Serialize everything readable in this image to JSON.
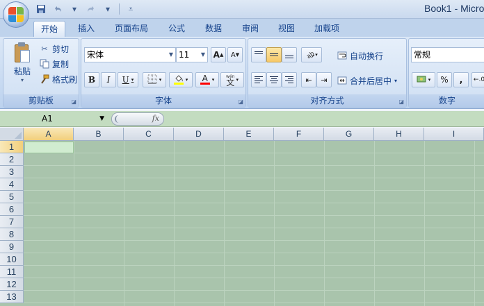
{
  "window": {
    "title": "Book1 - Micro"
  },
  "qat": {
    "save": "save-icon",
    "undo": "undo-icon",
    "redo": "redo-icon",
    "customize": "chevron-down-icon"
  },
  "tabs": [
    {
      "label": "开始",
      "active": true
    },
    {
      "label": "插入"
    },
    {
      "label": "页面布局"
    },
    {
      "label": "公式"
    },
    {
      "label": "数据"
    },
    {
      "label": "审阅"
    },
    {
      "label": "视图"
    },
    {
      "label": "加载项"
    }
  ],
  "clipboard": {
    "paste": "粘贴",
    "cut": "剪切",
    "copy": "复制",
    "format_painter": "格式刷",
    "group_label": "剪贴板"
  },
  "font": {
    "name": "宋体",
    "size": "11",
    "grow": "A",
    "shrink": "A",
    "bold": "B",
    "italic": "I",
    "underline": "U",
    "font_color_letter": "A",
    "phonetic": "wén",
    "phonetic_char": "文",
    "group_label": "字体",
    "highlight_color": "#ffff00",
    "font_color": "#ff0000"
  },
  "alignment": {
    "wrap_text": "自动换行",
    "merge_center": "合并后居中",
    "group_label": "对齐方式"
  },
  "number": {
    "format": "常规",
    "percent": "%",
    "comma": ",",
    "group_label": "数字"
  },
  "formula_bar": {
    "name_box": "A1",
    "fx": "fx"
  },
  "sheet": {
    "columns": [
      "A",
      "B",
      "C",
      "D",
      "E",
      "F",
      "G",
      "H",
      "I"
    ],
    "rows": [
      "1",
      "2",
      "3",
      "4",
      "5",
      "6",
      "7",
      "8",
      "9",
      "10",
      "11",
      "12",
      "13"
    ],
    "active_cell": "A1"
  }
}
